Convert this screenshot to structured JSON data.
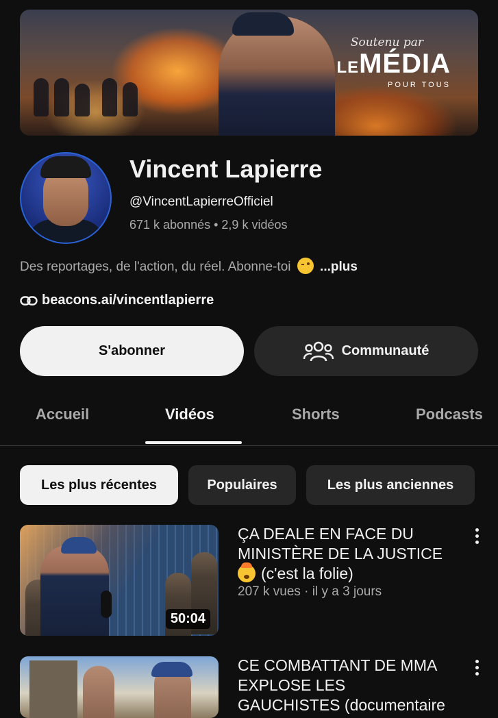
{
  "banner": {
    "brand_script": "Soutenu par",
    "brand_logo_le": "LE",
    "brand_logo_media": "MÉDIA",
    "brand_logo_sub": "POUR TOUS"
  },
  "channel": {
    "name": "Vincent Lapierre",
    "handle": "@VincentLapierreOfficiel",
    "subscribers": "671 k abonnés",
    "separator": " • ",
    "video_count": "2,9 k vidéos",
    "description": "Des reportages, de l'action, du réel. Abonne-toi",
    "more_label": "...plus",
    "link": "beacons.ai/vincentlapierre"
  },
  "actions": {
    "subscribe_label": "S'abonner",
    "community_label": "Communauté"
  },
  "tabs": [
    {
      "label": "Accueil",
      "active": false
    },
    {
      "label": "Vidéos",
      "active": true
    },
    {
      "label": "Shorts",
      "active": false
    },
    {
      "label": "Podcasts",
      "active": false
    }
  ],
  "filters": [
    {
      "label": "Les plus récentes",
      "active": true
    },
    {
      "label": "Populaires",
      "active": false
    },
    {
      "label": "Les plus anciennes",
      "active": false
    }
  ],
  "videos": [
    {
      "title_line1": "ÇA DEALE EN FACE DU",
      "title_line2": "MINISTÈRE DE LA JUSTICE",
      "title_line3": "(c'est la folie)",
      "title_emoji": "exploding-head-icon",
      "views": "207 k vues",
      "age": "il y a 3 jours",
      "meta_separator": " · ",
      "duration": "50:04"
    },
    {
      "title_line1": "CE COMBATTANT DE MMA",
      "title_line2": "EXPLOSE LES",
      "title_line3": "GAUCHISTES (documentaire"
    }
  ],
  "colors": {
    "background": "#0f0f0f",
    "text_primary": "#f1f1f1",
    "text_secondary": "#aaaaaa",
    "chip_bg": "#272727",
    "subscribe_bg": "#f1f1f1"
  }
}
